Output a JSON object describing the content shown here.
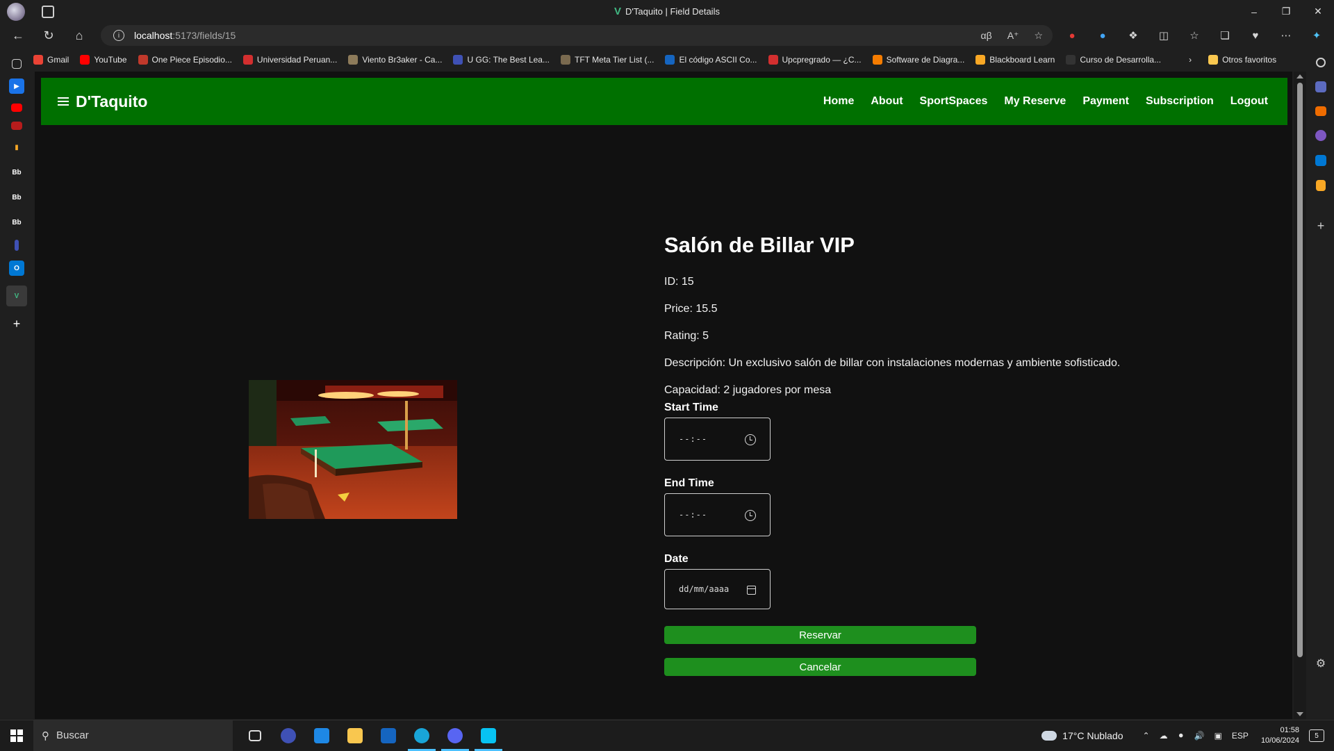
{
  "browser": {
    "tab_title": "D'Taquito | Field Details",
    "url_host": "localhost",
    "url_path": ":5173/fields/15",
    "bookmarks": [
      {
        "label": "Gmail",
        "color": "#ea4335"
      },
      {
        "label": "YouTube",
        "color": "#ff0000"
      },
      {
        "label": "One Piece Episodio...",
        "color": "#c0392b"
      },
      {
        "label": "Universidad Peruan...",
        "color": "#d32f2f"
      },
      {
        "label": "Viento Br3aker - Ca...",
        "color": "#8d7b5a"
      },
      {
        "label": "U GG: The Best Lea...",
        "color": "#3f51b5"
      },
      {
        "label": "TFT Meta Tier List (...",
        "color": "#7a6a4f"
      },
      {
        "label": "El código ASCII Co...",
        "color": "#1565c0"
      },
      {
        "label": "Upcpregrado — ¿C...",
        "color": "#d32f2f"
      },
      {
        "label": "Software de Diagra...",
        "color": "#f57c00"
      },
      {
        "label": "Blackboard Learn",
        "color": "#f9a825"
      },
      {
        "label": "Curso de Desarrolla...",
        "color": "#333333"
      }
    ],
    "other_favorites": "Otros favoritos"
  },
  "app": {
    "brand": "D'Taquito",
    "nav_links": [
      "Home",
      "About",
      "SportSpaces",
      "My Reserve",
      "Payment",
      "Subscription",
      "Logout"
    ],
    "accent_color": "#007000",
    "button_color": "#1e8f1e"
  },
  "field": {
    "name": "Salón de Billar VIP",
    "id_text": "ID: 15",
    "price_text": "Price: 15.5",
    "rating_text": "Rating: 5",
    "description_text": "Descripción: Un exclusivo salón de billar con instalaciones modernas y ambiente sofisticado.",
    "capacity_text": "Capacidad: 2 jugadores por mesa"
  },
  "form": {
    "start_time_label": "Start Time",
    "start_time_placeholder": "--:--",
    "end_time_label": "End Time",
    "end_time_placeholder": "--:--",
    "date_label": "Date",
    "date_placeholder": "dd/mm/aaaa",
    "reserve_button": "Reservar",
    "cancel_button": "Cancelar"
  },
  "taskbar": {
    "search_placeholder": "Buscar",
    "weather": "17°C  Nublado",
    "language": "ESP",
    "time": "01:58",
    "date": "10/06/2024",
    "notifications": "5"
  }
}
